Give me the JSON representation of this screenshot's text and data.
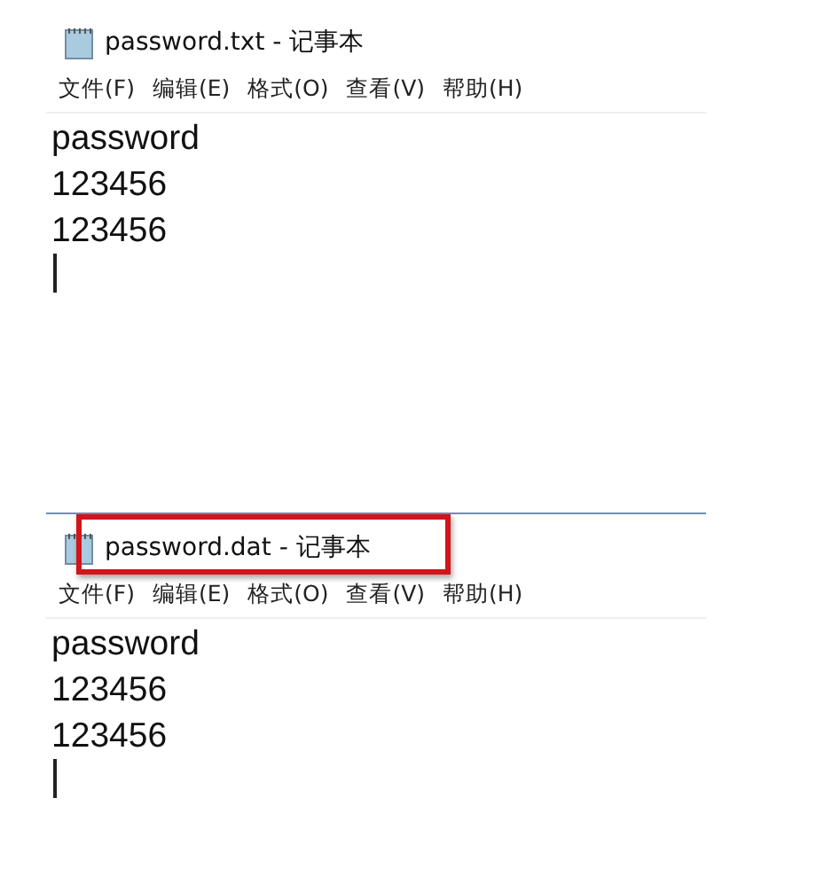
{
  "windows": [
    {
      "title": "password.txt - 记事本",
      "highlighted": false,
      "menu": [
        "文件(F)",
        "编辑(E)",
        "格式(O)",
        "查看(V)",
        "帮助(H)"
      ],
      "lines": [
        "password",
        "123456",
        "123456"
      ],
      "top_border": false
    },
    {
      "title": "password.dat - 记事本",
      "highlighted": true,
      "menu": [
        "文件(F)",
        "编辑(E)",
        "格式(O)",
        "查看(V)",
        "帮助(H)"
      ],
      "lines": [
        "password",
        "123456",
        "123456"
      ],
      "top_border": true
    }
  ]
}
